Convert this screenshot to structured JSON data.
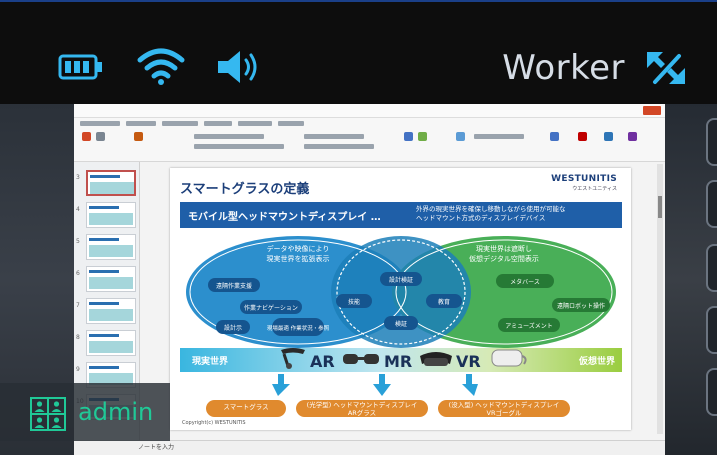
{
  "header": {
    "status_icons": [
      "battery-icon",
      "wifi-icon",
      "volume-icon"
    ],
    "mode_label": "Worker",
    "expand_icon": "expand-arrows-icon",
    "accent_color": "#35b8f0"
  },
  "slide": {
    "title": "スマートグラスの定義",
    "brand": "WESTUNITIS",
    "brand_sub": "ウエストユニティス",
    "banner_title": "モバイル型ヘッドマウントディスプレイ …",
    "banner_desc_1": "外界の現実世界を確保し移動しながら使用が可能な",
    "banner_desc_2": "ヘッドマウント方式のディスプレイデバイス",
    "left_circle_title_1": "データや映像により",
    "left_circle_title_2": "現実世界を拡張表示",
    "right_circle_title_1": "現実世界は遮断し",
    "right_circle_title_2": "仮想デジタル空間表示",
    "left_items": [
      "遠隔作業支援",
      "作業ナビゲーション",
      "設計示",
      "現場最適 作業状況・参照"
    ],
    "center_items": [
      "設計検証",
      "技能",
      "教育",
      "検証"
    ],
    "right_items": [
      "メタバース",
      "遠隔ロボット操作",
      "アミューズメント"
    ],
    "band_left": "現実世界",
    "band_right": "仮想世界",
    "tech": [
      "AR",
      "MR",
      "VR"
    ],
    "pills": [
      {
        "line1": "スマートグラス",
        "line2": ""
      },
      {
        "line1": "(光学型) ヘッドマウントディスプレイ",
        "line2": "ARグラス"
      },
      {
        "line1": "(没入型) ヘッドマウントディスプレイ",
        "line2": "VRゴーグル"
      }
    ],
    "footer_note": "Copyright(c) WESTUNITIS",
    "slide_num": ""
  },
  "app": {
    "notes_hint": "ノートを入力"
  },
  "user": {
    "name": "admin",
    "name_color": "#20c997",
    "icon": "users-grid-icon"
  }
}
